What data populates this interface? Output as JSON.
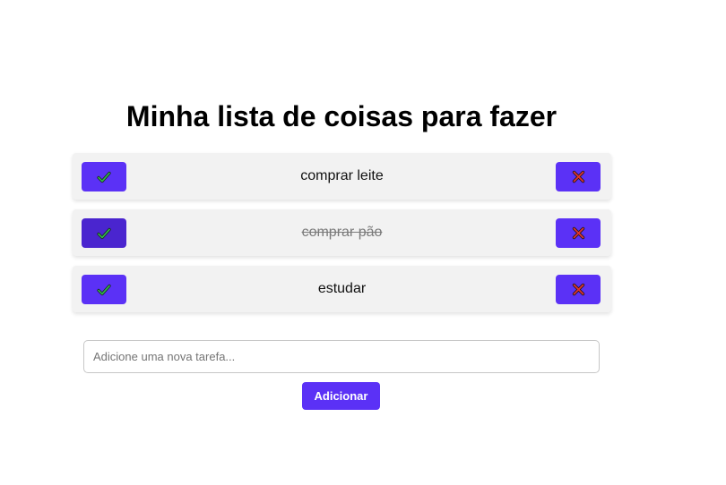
{
  "page": {
    "title": "Minha lista de coisas para fazer"
  },
  "tasks": [
    {
      "text": "comprar leite",
      "done": false
    },
    {
      "text": "comprar pão",
      "done": true
    },
    {
      "text": "estudar",
      "done": false
    }
  ],
  "icons": {
    "check": "check-icon",
    "delete": "x-mark-icon"
  },
  "colors": {
    "accent": "#5b31f6",
    "accent_pressed": "#4a25cf",
    "check_green": "#2fb34a",
    "delete_red": "#e0322e"
  },
  "form": {
    "placeholder": "Adicione uma nova tarefa...",
    "value": "",
    "add_label": "Adicionar"
  }
}
